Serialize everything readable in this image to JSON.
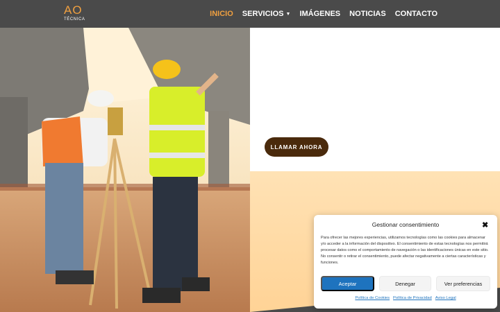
{
  "header": {
    "logo_main": "AO",
    "logo_sub": "TÉCNICA",
    "nav": [
      {
        "label": "INICIO",
        "active": true
      },
      {
        "label": "SERVICIOS",
        "has_dropdown": true
      },
      {
        "label": "IMÁGENES"
      },
      {
        "label": "NOTICIAS"
      },
      {
        "label": "CONTACTO"
      }
    ],
    "accent_color": "#f0a040"
  },
  "hero": {
    "call_button_label": "LLAMAR AHORA",
    "button_color": "#4a2a0c"
  },
  "cookie_modal": {
    "title": "Gestionar consentimiento",
    "body": "Para ofrecer las mejores experiencias, utilizamos tecnologías como las cookies para almacenar y/o acceder a la información del dispositivo. El consentimiento de estas tecnologías nos permitirá procesar datos como el comportamiento de navegación o las identificaciones únicas en este sitio. No consentir o retirar el consentimiento, puede afectar negativamente a ciertas características y funciones.",
    "accept_label": "Aceptar",
    "deny_label": "Denegar",
    "prefs_label": "Ver preferencias",
    "links": [
      "Política de Cookies",
      "Política de Privacidad",
      "Aviso Legal"
    ],
    "accept_color": "#1e73be"
  }
}
